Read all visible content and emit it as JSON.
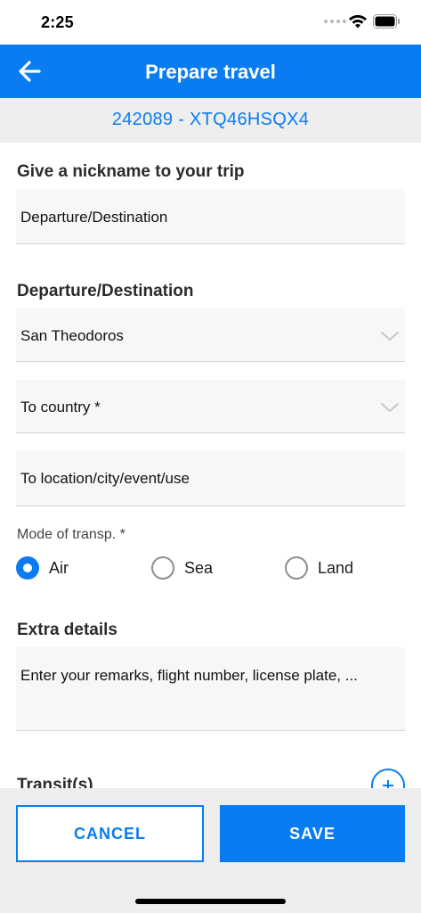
{
  "status_bar": {
    "time": "2:25"
  },
  "header": {
    "title": "Prepare travel",
    "back_icon": "arrow-left-icon"
  },
  "trip_id": "242089 - XTQ46HSQX4",
  "nickname_section": {
    "title": "Give a nickname to your trip",
    "value": "Departure/Destination"
  },
  "departure_section": {
    "title": "Departure/Destination",
    "from_country": "San Theodoros",
    "to_country_placeholder": "To country *",
    "to_location_placeholder": "To location/city/event/use"
  },
  "mode_of_transport": {
    "label": "Mode of transp. *",
    "options": [
      {
        "label": "Air",
        "selected": true
      },
      {
        "label": "Sea",
        "selected": false
      },
      {
        "label": "Land",
        "selected": false
      }
    ]
  },
  "extra_details": {
    "title": "Extra details",
    "placeholder": "Enter your remarks, flight number, license plate, ..."
  },
  "transit_section": {
    "title": "Transit(s)",
    "add_icon": "plus-circle-icon"
  },
  "footer": {
    "cancel_label": "CANCEL",
    "save_label": "SAVE"
  },
  "colors": {
    "accent": "#0a7cf2",
    "background_gray": "#eeeeee",
    "field_background": "#f7f7f7"
  }
}
